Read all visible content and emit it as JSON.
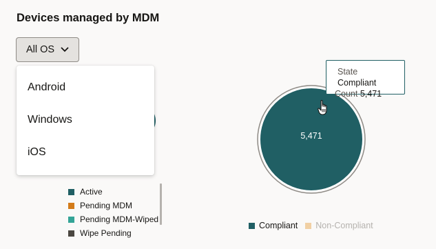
{
  "title": "Devices managed by MDM",
  "os_filter": {
    "selected": "All OS",
    "options": [
      "Android",
      "Windows",
      "iOS"
    ]
  },
  "left_legend": [
    {
      "label": "Active",
      "color": "#205f64"
    },
    {
      "label": "Pending MDM",
      "color": "#d37b1a"
    },
    {
      "label": "Pending MDM-Wiped",
      "color": "#34a497"
    },
    {
      "label": "Wipe Pending",
      "color": "#4b4741"
    }
  ],
  "tooltip": {
    "state_key": "State",
    "state_value": "Compliant",
    "count_key": "Count",
    "count_value": "5,471"
  },
  "chart_data": {
    "type": "pie",
    "title": "",
    "categories": [
      "Compliant",
      "Non-Compliant"
    ],
    "values": [
      5471,
      0
    ],
    "colors": [
      "#205f64",
      "#f1d0a4"
    ],
    "data_labels": [
      "5,471"
    ],
    "legend_position": "bottom"
  },
  "right_legend": [
    {
      "label": "Compliant",
      "color": "#205f64",
      "text_color": "#161513"
    },
    {
      "label": "Non-Compliant",
      "color": "#f1d0a4",
      "text_color": "#b5b2ae"
    }
  ]
}
